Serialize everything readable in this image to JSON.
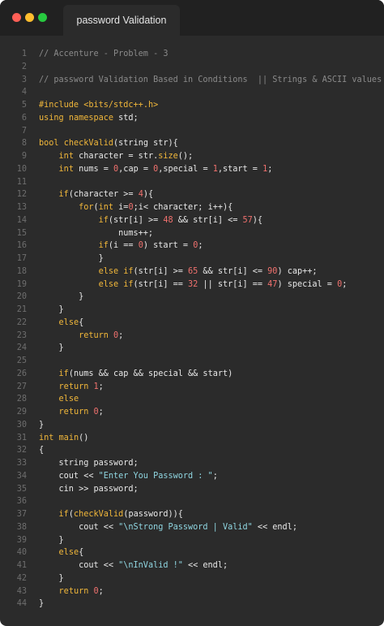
{
  "window": {
    "tab_title": "password Validation",
    "controls": [
      "close",
      "minimize",
      "maximize"
    ]
  },
  "colors": {
    "background": "#2b2b2b",
    "titlebar": "#212121",
    "comment": "#8a8a8a",
    "keyword": "#f1b73a",
    "number": "#f0716e",
    "string": "#8fd6e1",
    "text": "#e8e8e8",
    "line_number": "#6e6e6e"
  },
  "editor": {
    "lines": [
      [
        [
          "cm",
          "// Accenture - Problem - 3"
        ]
      ],
      [],
      [
        [
          "cm",
          "// password Validation Based in Conditions  || Strings & ASCII values"
        ]
      ],
      [],
      [
        [
          "kw",
          "#include"
        ],
        [
          "t",
          " "
        ],
        [
          "kw",
          "<bits/stdc++.h>"
        ]
      ],
      [
        [
          "kw",
          "using"
        ],
        [
          "t",
          " "
        ],
        [
          "kw",
          "namespace"
        ],
        [
          "t",
          " std;"
        ]
      ],
      [],
      [
        [
          "kw",
          "bool"
        ],
        [
          "t",
          " "
        ],
        [
          "kw",
          "checkValid"
        ],
        [
          "t",
          "(string str){"
        ]
      ],
      [
        [
          "t",
          "    "
        ],
        [
          "kw",
          "int"
        ],
        [
          "t",
          " character = str."
        ],
        [
          "kw",
          "size"
        ],
        [
          "t",
          "();"
        ]
      ],
      [
        [
          "t",
          "    "
        ],
        [
          "kw",
          "int"
        ],
        [
          "t",
          " nums = "
        ],
        [
          "num",
          "0"
        ],
        [
          "t",
          ",cap = "
        ],
        [
          "num",
          "0"
        ],
        [
          "t",
          ",special = "
        ],
        [
          "num",
          "1"
        ],
        [
          "t",
          ",start = "
        ],
        [
          "num",
          "1"
        ],
        [
          "t",
          ";"
        ]
      ],
      [],
      [
        [
          "t",
          "    "
        ],
        [
          "kw",
          "if"
        ],
        [
          "t",
          "(character >= "
        ],
        [
          "num",
          "4"
        ],
        [
          "t",
          "){"
        ]
      ],
      [
        [
          "t",
          "        "
        ],
        [
          "kw",
          "for"
        ],
        [
          "t",
          "("
        ],
        [
          "kw",
          "int"
        ],
        [
          "t",
          " i="
        ],
        [
          "num",
          "0"
        ],
        [
          "t",
          ";i< character; i++){"
        ]
      ],
      [
        [
          "t",
          "            "
        ],
        [
          "kw",
          "if"
        ],
        [
          "t",
          "(str[i] >= "
        ],
        [
          "num",
          "48"
        ],
        [
          "t",
          " && str[i] <= "
        ],
        [
          "num",
          "57"
        ],
        [
          "t",
          "){"
        ]
      ],
      [
        [
          "t",
          "                nums++;"
        ]
      ],
      [
        [
          "t",
          "            "
        ],
        [
          "kw",
          "if"
        ],
        [
          "t",
          "(i == "
        ],
        [
          "num",
          "0"
        ],
        [
          "t",
          ") start = "
        ],
        [
          "num",
          "0"
        ],
        [
          "t",
          ";"
        ]
      ],
      [
        [
          "t",
          "            }"
        ]
      ],
      [
        [
          "t",
          "            "
        ],
        [
          "kw",
          "else if"
        ],
        [
          "t",
          "(str[i] >= "
        ],
        [
          "num",
          "65"
        ],
        [
          "t",
          " && str[i] <= "
        ],
        [
          "num",
          "90"
        ],
        [
          "t",
          ") cap++;"
        ]
      ],
      [
        [
          "t",
          "            "
        ],
        [
          "kw",
          "else if"
        ],
        [
          "t",
          "(str[i] == "
        ],
        [
          "num",
          "32"
        ],
        [
          "t",
          " || str[i] == "
        ],
        [
          "num",
          "47"
        ],
        [
          "t",
          ") special = "
        ],
        [
          "num",
          "0"
        ],
        [
          "t",
          ";"
        ]
      ],
      [
        [
          "t",
          "        }"
        ]
      ],
      [
        [
          "t",
          "    }"
        ]
      ],
      [
        [
          "t",
          "    "
        ],
        [
          "kw",
          "else"
        ],
        [
          "t",
          "{"
        ]
      ],
      [
        [
          "t",
          "        "
        ],
        [
          "kw",
          "return"
        ],
        [
          "t",
          " "
        ],
        [
          "num",
          "0"
        ],
        [
          "t",
          ";"
        ]
      ],
      [
        [
          "t",
          "    }"
        ]
      ],
      [],
      [
        [
          "t",
          "    "
        ],
        [
          "kw",
          "if"
        ],
        [
          "t",
          "(nums && cap && special && start)"
        ]
      ],
      [
        [
          "t",
          "    "
        ],
        [
          "kw",
          "return"
        ],
        [
          "t",
          " "
        ],
        [
          "num",
          "1"
        ],
        [
          "t",
          ";"
        ]
      ],
      [
        [
          "t",
          "    "
        ],
        [
          "kw",
          "else"
        ]
      ],
      [
        [
          "t",
          "    "
        ],
        [
          "kw",
          "return"
        ],
        [
          "t",
          " "
        ],
        [
          "num",
          "0"
        ],
        [
          "t",
          ";"
        ]
      ],
      [
        [
          "t",
          "}"
        ]
      ],
      [
        [
          "kw",
          "int"
        ],
        [
          "t",
          " "
        ],
        [
          "kw",
          "main"
        ],
        [
          "t",
          "()"
        ]
      ],
      [
        [
          "t",
          "{"
        ]
      ],
      [
        [
          "t",
          "    string password;"
        ]
      ],
      [
        [
          "t",
          "    cout << "
        ],
        [
          "str",
          "\"Enter You Password : \""
        ],
        [
          "t",
          ";"
        ]
      ],
      [
        [
          "t",
          "    cin >> password;"
        ]
      ],
      [],
      [
        [
          "t",
          "    "
        ],
        [
          "kw",
          "if"
        ],
        [
          "t",
          "("
        ],
        [
          "kw",
          "checkValid"
        ],
        [
          "t",
          "(password)){"
        ]
      ],
      [
        [
          "t",
          "        cout << "
        ],
        [
          "str",
          "\"\\nStrong Password | Valid\""
        ],
        [
          "t",
          " << endl;"
        ]
      ],
      [
        [
          "t",
          "    }"
        ]
      ],
      [
        [
          "t",
          "    "
        ],
        [
          "kw",
          "else"
        ],
        [
          "t",
          "{"
        ]
      ],
      [
        [
          "t",
          "        cout << "
        ],
        [
          "str",
          "\"\\nInValid !\""
        ],
        [
          "t",
          " << endl;"
        ]
      ],
      [
        [
          "t",
          "    }"
        ]
      ],
      [
        [
          "t",
          "    "
        ],
        [
          "kw",
          "return"
        ],
        [
          "t",
          " "
        ],
        [
          "num",
          "0"
        ],
        [
          "t",
          ";"
        ]
      ],
      [
        [
          "t",
          "}"
        ]
      ]
    ]
  }
}
